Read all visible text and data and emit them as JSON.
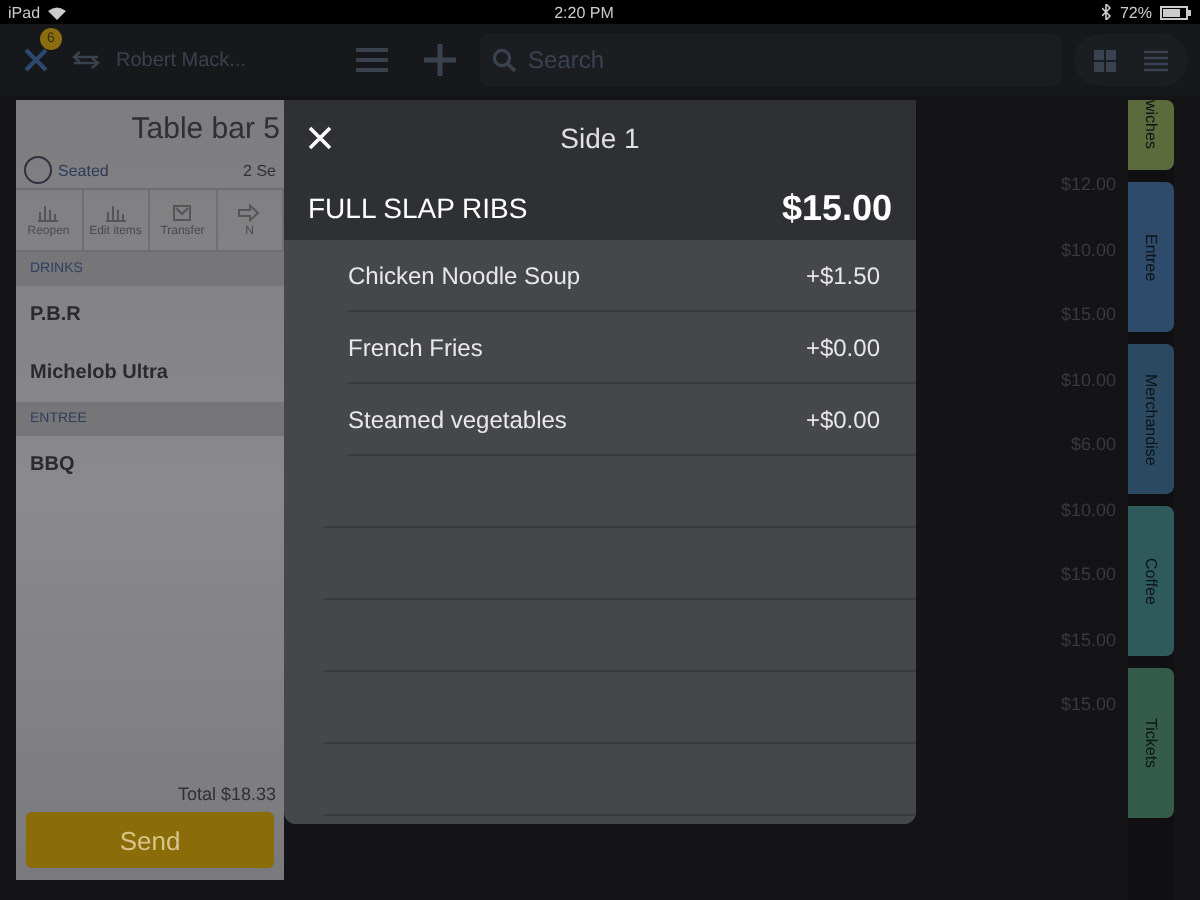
{
  "status_bar": {
    "device": "iPad",
    "time": "2:20 PM",
    "battery": "72%"
  },
  "toolbar": {
    "badge": "6",
    "user": "Robert Mack...",
    "search": {
      "placeholder": "Search"
    }
  },
  "order": {
    "title": "Table bar 5",
    "status": "Seated",
    "seats": "2 Se",
    "actions": [
      "Reopen",
      "Edit items",
      "Transfer",
      "N"
    ],
    "sections": [
      {
        "name": "DRINKS",
        "items": [
          "P.B.R",
          "Michelob Ultra"
        ]
      },
      {
        "name": "ENTREE",
        "items": [
          "BBQ"
        ]
      }
    ],
    "total": "Total $18.33",
    "send": "Send"
  },
  "modal": {
    "title": "Side 1",
    "item": "FULL SLAP RIBS",
    "price": "$15.00",
    "options": [
      {
        "name": "Chicken Noodle Soup",
        "price": "+$1.50"
      },
      {
        "name": "French Fries",
        "price": "+$0.00"
      },
      {
        "name": "Steamed vegetables",
        "price": "+$0.00"
      }
    ]
  },
  "menu_prices": [
    "$12.00",
    "$10.00",
    "$15.00",
    "$10.00",
    "$6.00",
    "$10.00",
    "$15.00",
    "$15.00",
    "$15.00"
  ],
  "category_tabs": [
    {
      "label": "wiches",
      "color": "#5b6b3c"
    },
    {
      "label": "Entree",
      "color": "#2e4b6b"
    },
    {
      "label": "Merchandise",
      "color": "#2b4a62"
    },
    {
      "label": "Coffee",
      "color": "#2e5a5c"
    },
    {
      "label": "Tickets",
      "color": "#355b4b"
    }
  ]
}
